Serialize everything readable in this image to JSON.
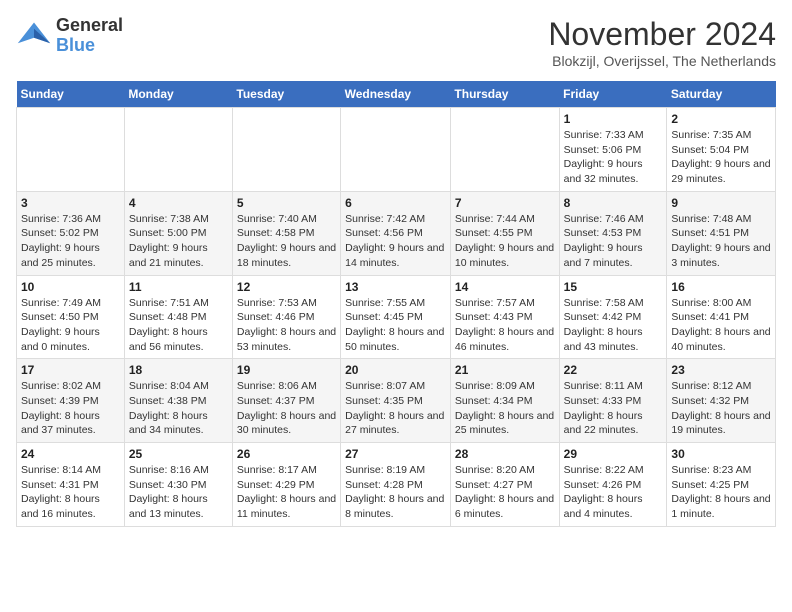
{
  "header": {
    "logo_line1": "General",
    "logo_line2": "Blue",
    "month_title": "November 2024",
    "location": "Blokzijl, Overijssel, The Netherlands"
  },
  "weekdays": [
    "Sunday",
    "Monday",
    "Tuesday",
    "Wednesday",
    "Thursday",
    "Friday",
    "Saturday"
  ],
  "weeks": [
    [
      {
        "day": "",
        "info": ""
      },
      {
        "day": "",
        "info": ""
      },
      {
        "day": "",
        "info": ""
      },
      {
        "day": "",
        "info": ""
      },
      {
        "day": "",
        "info": ""
      },
      {
        "day": "1",
        "info": "Sunrise: 7:33 AM\nSunset: 5:06 PM\nDaylight: 9 hours and 32 minutes."
      },
      {
        "day": "2",
        "info": "Sunrise: 7:35 AM\nSunset: 5:04 PM\nDaylight: 9 hours and 29 minutes."
      }
    ],
    [
      {
        "day": "3",
        "info": "Sunrise: 7:36 AM\nSunset: 5:02 PM\nDaylight: 9 hours and 25 minutes."
      },
      {
        "day": "4",
        "info": "Sunrise: 7:38 AM\nSunset: 5:00 PM\nDaylight: 9 hours and 21 minutes."
      },
      {
        "day": "5",
        "info": "Sunrise: 7:40 AM\nSunset: 4:58 PM\nDaylight: 9 hours and 18 minutes."
      },
      {
        "day": "6",
        "info": "Sunrise: 7:42 AM\nSunset: 4:56 PM\nDaylight: 9 hours and 14 minutes."
      },
      {
        "day": "7",
        "info": "Sunrise: 7:44 AM\nSunset: 4:55 PM\nDaylight: 9 hours and 10 minutes."
      },
      {
        "day": "8",
        "info": "Sunrise: 7:46 AM\nSunset: 4:53 PM\nDaylight: 9 hours and 7 minutes."
      },
      {
        "day": "9",
        "info": "Sunrise: 7:48 AM\nSunset: 4:51 PM\nDaylight: 9 hours and 3 minutes."
      }
    ],
    [
      {
        "day": "10",
        "info": "Sunrise: 7:49 AM\nSunset: 4:50 PM\nDaylight: 9 hours and 0 minutes."
      },
      {
        "day": "11",
        "info": "Sunrise: 7:51 AM\nSunset: 4:48 PM\nDaylight: 8 hours and 56 minutes."
      },
      {
        "day": "12",
        "info": "Sunrise: 7:53 AM\nSunset: 4:46 PM\nDaylight: 8 hours and 53 minutes."
      },
      {
        "day": "13",
        "info": "Sunrise: 7:55 AM\nSunset: 4:45 PM\nDaylight: 8 hours and 50 minutes."
      },
      {
        "day": "14",
        "info": "Sunrise: 7:57 AM\nSunset: 4:43 PM\nDaylight: 8 hours and 46 minutes."
      },
      {
        "day": "15",
        "info": "Sunrise: 7:58 AM\nSunset: 4:42 PM\nDaylight: 8 hours and 43 minutes."
      },
      {
        "day": "16",
        "info": "Sunrise: 8:00 AM\nSunset: 4:41 PM\nDaylight: 8 hours and 40 minutes."
      }
    ],
    [
      {
        "day": "17",
        "info": "Sunrise: 8:02 AM\nSunset: 4:39 PM\nDaylight: 8 hours and 37 minutes."
      },
      {
        "day": "18",
        "info": "Sunrise: 8:04 AM\nSunset: 4:38 PM\nDaylight: 8 hours and 34 minutes."
      },
      {
        "day": "19",
        "info": "Sunrise: 8:06 AM\nSunset: 4:37 PM\nDaylight: 8 hours and 30 minutes."
      },
      {
        "day": "20",
        "info": "Sunrise: 8:07 AM\nSunset: 4:35 PM\nDaylight: 8 hours and 27 minutes."
      },
      {
        "day": "21",
        "info": "Sunrise: 8:09 AM\nSunset: 4:34 PM\nDaylight: 8 hours and 25 minutes."
      },
      {
        "day": "22",
        "info": "Sunrise: 8:11 AM\nSunset: 4:33 PM\nDaylight: 8 hours and 22 minutes."
      },
      {
        "day": "23",
        "info": "Sunrise: 8:12 AM\nSunset: 4:32 PM\nDaylight: 8 hours and 19 minutes."
      }
    ],
    [
      {
        "day": "24",
        "info": "Sunrise: 8:14 AM\nSunset: 4:31 PM\nDaylight: 8 hours and 16 minutes."
      },
      {
        "day": "25",
        "info": "Sunrise: 8:16 AM\nSunset: 4:30 PM\nDaylight: 8 hours and 13 minutes."
      },
      {
        "day": "26",
        "info": "Sunrise: 8:17 AM\nSunset: 4:29 PM\nDaylight: 8 hours and 11 minutes."
      },
      {
        "day": "27",
        "info": "Sunrise: 8:19 AM\nSunset: 4:28 PM\nDaylight: 8 hours and 8 minutes."
      },
      {
        "day": "28",
        "info": "Sunrise: 8:20 AM\nSunset: 4:27 PM\nDaylight: 8 hours and 6 minutes."
      },
      {
        "day": "29",
        "info": "Sunrise: 8:22 AM\nSunset: 4:26 PM\nDaylight: 8 hours and 4 minutes."
      },
      {
        "day": "30",
        "info": "Sunrise: 8:23 AM\nSunset: 4:25 PM\nDaylight: 8 hours and 1 minute."
      }
    ]
  ]
}
